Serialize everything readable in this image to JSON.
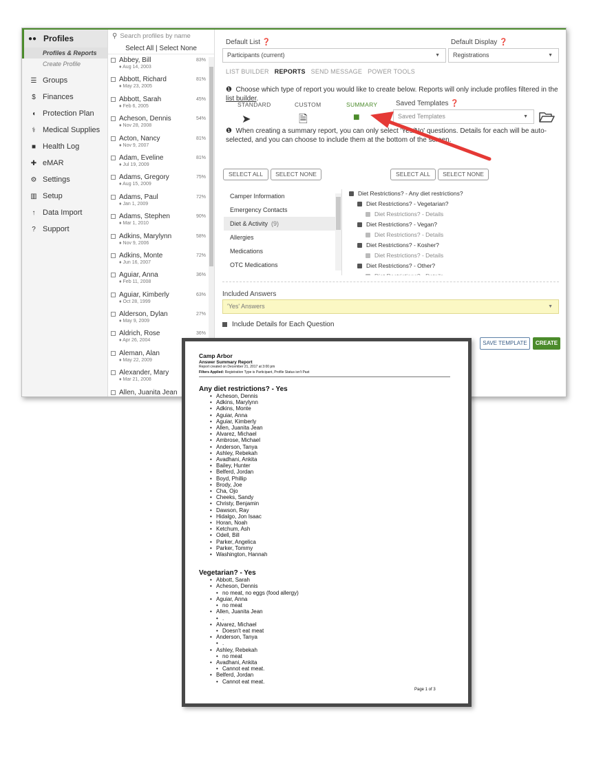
{
  "sidebar": {
    "profiles": "Profiles",
    "sub_items": [
      "Profiles & Reports",
      "Create Profile"
    ],
    "items": [
      {
        "label": "Groups",
        "icon": "sitemap-icon"
      },
      {
        "label": "Finances",
        "icon": "dollar-icon"
      },
      {
        "label": "Protection Plan",
        "icon": "shield-icon"
      },
      {
        "label": "Medical Supplies",
        "icon": "stethoscope-icon"
      },
      {
        "label": "Health Log",
        "icon": "book-icon"
      },
      {
        "label": "eMAR",
        "icon": "medkit-icon"
      },
      {
        "label": "Settings",
        "icon": "gear-icon"
      },
      {
        "label": "Setup",
        "icon": "map-icon"
      },
      {
        "label": "Data Import",
        "icon": "upload-icon"
      },
      {
        "label": "Support",
        "icon": "question-icon"
      }
    ]
  },
  "profile_list": {
    "search_placeholder": "Search profiles by name",
    "select_all": "Select All",
    "separator": "|",
    "select_none": "Select None",
    "rows": [
      {
        "name": "Abbey, Bill",
        "date": "Aug 14, 2003",
        "pct": "83%"
      },
      {
        "name": "Abbott, Richard",
        "date": "May 23, 2005",
        "pct": "81%"
      },
      {
        "name": "Abbott, Sarah",
        "date": "Feb 6, 2005",
        "pct": "45%"
      },
      {
        "name": "Acheson, Dennis",
        "date": "Nov 28, 2008",
        "pct": "54%"
      },
      {
        "name": "Acton, Nancy",
        "date": "Nov 9, 2007",
        "pct": "81%"
      },
      {
        "name": "Adam, Eveline",
        "date": "Jul 19, 2009",
        "pct": "81%"
      },
      {
        "name": "Adams, Gregory",
        "date": "Aug 15, 2009",
        "pct": "75%"
      },
      {
        "name": "Adams, Paul",
        "date": "Jan 1, 2009",
        "pct": "72%"
      },
      {
        "name": "Adams, Stephen",
        "date": "Mar 1, 2010",
        "pct": "90%"
      },
      {
        "name": "Adkins, Marylynn",
        "date": "Nov 9, 2006",
        "pct": "58%"
      },
      {
        "name": "Adkins, Monte",
        "date": "Jun 16, 2007",
        "pct": "72%"
      },
      {
        "name": "Aguiar, Anna",
        "date": "Feb 11, 2008",
        "pct": "36%"
      },
      {
        "name": "Aguiar, Kimberly",
        "date": "Oct 28, 1999",
        "pct": "63%"
      },
      {
        "name": "Alderson, Dylan",
        "date": "May 9, 2009",
        "pct": "27%"
      },
      {
        "name": "Aldrich, Rose",
        "date": "Apr 26, 2004",
        "pct": "36%"
      },
      {
        "name": "Aleman, Alan",
        "date": "May 22, 2009",
        "pct": ""
      },
      {
        "name": "Alexander, Mary",
        "date": "Mar 21, 2008",
        "pct": ""
      },
      {
        "name": "Allen, Juanita Jean",
        "date": "",
        "pct": ""
      }
    ]
  },
  "main": {
    "default_list_label": "Default List",
    "default_list_value": "Participants (current)",
    "default_display_label": "Default Display",
    "default_display_value": "Registrations",
    "tabs": [
      "LIST BUILDER",
      "REPORTS",
      "SEND MESSAGE",
      "POWER TOOLS"
    ],
    "report_prompt": "Choose which type of report you would like to create below. Reports will only include profiles filtered in the",
    "report_prompt_link": "list builder",
    "report_prompt_end": ".",
    "report_types": [
      "STANDARD",
      "CUSTOM",
      "SUMMARY"
    ],
    "saved_templates_label": "Saved Templates",
    "saved_templates_placeholder": "Saved Templates",
    "summary_note": "When creating a summary report, you can only select 'Yes/No' questions. Details for each will be auto-selected, and you can choose to include them at the bottom of the screen.",
    "select_all": "SELECT ALL",
    "select_none": "SELECT NONE",
    "categories": [
      {
        "label": "Camper Information",
        "count": ""
      },
      {
        "label": "Emergency Contacts",
        "count": ""
      },
      {
        "label": "Diet & Activity",
        "count": "(9)"
      },
      {
        "label": "Allergies",
        "count": ""
      },
      {
        "label": "Medications",
        "count": ""
      },
      {
        "label": "OTC Medications",
        "count": ""
      }
    ],
    "questions": [
      {
        "label": "Diet Restrictions? - Any diet restrictions?",
        "level": 0
      },
      {
        "label": "Diet Restrictions? - Vegetarian?",
        "level": 1
      },
      {
        "label": "Diet Restrictions? - Details",
        "level": 2
      },
      {
        "label": "Diet Restrictions? - Vegan?",
        "level": 1
      },
      {
        "label": "Diet Restrictions? - Details",
        "level": 2
      },
      {
        "label": "Diet Restrictions? - Kosher?",
        "level": 1
      },
      {
        "label": "Diet Restrictions? - Details",
        "level": 2
      },
      {
        "label": "Diet Restrictions? - Other?",
        "level": 1
      },
      {
        "label": "Diet Restrictions? - Details",
        "level": 2
      }
    ],
    "included_answers_label": "Included Answers",
    "included_answers_value": "'Yes' Answers",
    "include_details": "Include Details for Each Question",
    "save_template": "SAVE TEMPLATE",
    "create": "CREATE"
  },
  "report": {
    "title": "Camp Arbor",
    "subtitle": "Answer Summary Report",
    "created": "Report created on December 21, 2017 at 3:00 pm",
    "filters_label": "Filters Applied:",
    "filters_value": "Registration Type is Participant, Profile Status isn't Past",
    "section1_title": "Any diet restrictions? - Yes",
    "section1_names": [
      "Acheson, Dennis",
      "Adkins, Marylynn",
      "Adkins, Monte",
      "Aguiar, Anna",
      "Aguiar, Kimberly",
      "Allen, Juanita Jean",
      "Alvarez, Michael",
      "Ambrose, Michael",
      "Anderson, Tanya",
      "Ashley, Rebekah",
      "Avadhani, Ankita",
      "Bailey, Hunter",
      "Belferd, Jordan",
      "Boyd, Phillip",
      "Brody, Joe",
      "Cha, Ojo",
      "Cheeks, Sandy",
      "Christy, Benjamin",
      "Dawson, Ray",
      "Hidalgo, Jon Isaac",
      "Horan, Noah",
      "Ketchum, Ash",
      "Odell, Bill",
      "Parker, Angelica",
      "Parker, Tommy",
      "Washington, Hannah"
    ],
    "section2_title": "Vegetarian? - Yes",
    "section2_entries": [
      {
        "name": "Abbott, Sarah",
        "detail": null
      },
      {
        "name": "Acheson, Dennis",
        "detail": "no meat, no eggs (food allergy)"
      },
      {
        "name": "Aguiar, Anna",
        "detail": "no meat"
      },
      {
        "name": "Allen, Juanita Jean",
        "detail": "."
      },
      {
        "name": "Alvarez, Michael",
        "detail": "Doesn't eat meat"
      },
      {
        "name": "Anderson, Tanya",
        "detail": "."
      },
      {
        "name": "Ashley, Rebekah",
        "detail": "no meat"
      },
      {
        "name": "Avadhani, Ankita",
        "detail": "Cannot eat meat."
      },
      {
        "name": "Belferd, Jordan",
        "detail": "Cannot eat meat."
      }
    ],
    "page": "Page 1 of 3"
  },
  "colors": {
    "accent": "#4b8b2b",
    "arrow": "#e53935",
    "highlight": "#fbf8c4"
  }
}
